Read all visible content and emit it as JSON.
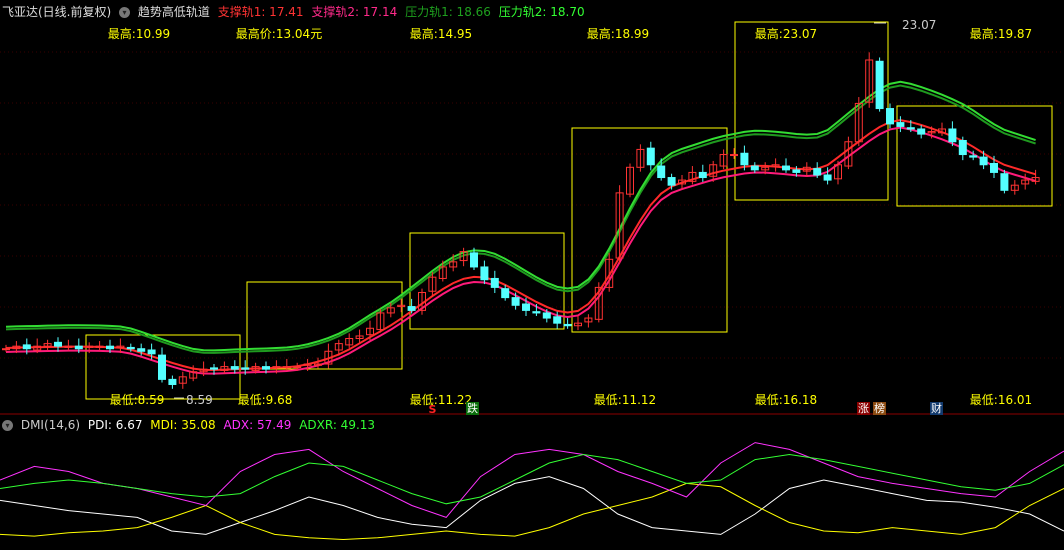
{
  "header": {
    "stock": "飞亚达(日线.前复权)",
    "indicator": "趋势高低轨道",
    "s1": "支撑轨1: 17.41",
    "s2": "支撑轨2: 17.14",
    "r1": "压力轨1: 18.66",
    "r2": "压力轨2: 18.70"
  },
  "dmi": {
    "name": "DMI(14,6)",
    "pdi": "PDI: 6.67",
    "mdi": "MDI: 35.08",
    "adx": "ADX: 57.49",
    "adxr": "ADXR: 49.13"
  },
  "box_labels": {
    "highs": [
      "最高:10.99",
      "最高价:13.04元",
      "最高:14.95",
      "最高:18.99",
      "最高:23.07",
      "最高:19.87"
    ],
    "lows": [
      "最低:8.59",
      "最低:9.68",
      "最低:11.22",
      "最低:11.12",
      "最低:16.18",
      "最低:16.01"
    ]
  },
  "markers": {
    "max_price": "23.07",
    "min_price": "8.59",
    "s": "S",
    "die": "跌",
    "zhang": "涨",
    "bang": "榜",
    "cai": "财"
  },
  "colors": {
    "up": "#ff3333",
    "down": "#54ffff",
    "green": "#00cc00",
    "red": "#ff1a4a",
    "box": "#ffff00"
  },
  "chart_data": {
    "type": "candlestick",
    "ylim": [
      8.0,
      24.0
    ],
    "closes": [
      10.4,
      10.5,
      10.4,
      10.5,
      10.6,
      10.5,
      10.5,
      10.4,
      10.5,
      10.5,
      10.4,
      10.5,
      10.4,
      10.3,
      10.2,
      9.2,
      9.0,
      9.3,
      9.5,
      9.6,
      9.6,
      9.7,
      9.6,
      9.6,
      9.7,
      9.6,
      9.7,
      9.7,
      9.7,
      9.8,
      9.8,
      10.3,
      10.6,
      10.8,
      10.9,
      11.2,
      11.8,
      12.0,
      12.1,
      11.9,
      12.6,
      13.2,
      13.6,
      13.8,
      14.2,
      13.6,
      13.1,
      12.8,
      12.4,
      12.1,
      11.9,
      11.8,
      11.6,
      11.4,
      11.3,
      11.4,
      11.6,
      12.8,
      13.9,
      16.5,
      17.5,
      18.2,
      17.6,
      17.1,
      16.8,
      17.0,
      17.3,
      17.1,
      17.6,
      18.0,
      18.0,
      17.6,
      17.4,
      17.5,
      17.6,
      17.4,
      17.3,
      17.5,
      17.2,
      17.0,
      17.6,
      18.5,
      20.0,
      21.7,
      19.8,
      19.2,
      19.1,
      19.0,
      18.8,
      18.9,
      19.0,
      18.5,
      18.0,
      17.9,
      17.6,
      17.3,
      16.6,
      16.8,
      17.0,
      17.1
    ],
    "dmi_series": [
      {
        "name": "PDI",
        "color": "#ffffff",
        "values": [
          28,
          25,
          22,
          20,
          18,
          10,
          8,
          15,
          22,
          30,
          25,
          18,
          14,
          12,
          28,
          38,
          42,
          35,
          20,
          12,
          10,
          8,
          20,
          35,
          40,
          36,
          32,
          28,
          27,
          24,
          20,
          10
        ]
      },
      {
        "name": "MDI",
        "color": "#ffff00",
        "values": [
          8,
          7,
          9,
          10,
          12,
          18,
          25,
          15,
          8,
          6,
          5,
          6,
          8,
          10,
          8,
          7,
          12,
          20,
          25,
          30,
          38,
          36,
          25,
          15,
          10,
          9,
          12,
          10,
          8,
          12,
          25,
          35
        ]
      },
      {
        "name": "ADX",
        "color": "#ff33ff",
        "values": [
          40,
          48,
          45,
          38,
          35,
          30,
          25,
          45,
          55,
          58,
          45,
          35,
          25,
          18,
          42,
          55,
          58,
          55,
          45,
          38,
          30,
          50,
          62,
          58,
          50,
          42,
          38,
          35,
          32,
          30,
          45,
          57
        ]
      },
      {
        "name": "ADXR",
        "color": "#33ff33",
        "values": [
          35,
          38,
          40,
          38,
          35,
          32,
          30,
          32,
          42,
          50,
          48,
          40,
          32,
          26,
          30,
          40,
          50,
          55,
          52,
          45,
          38,
          40,
          52,
          55,
          52,
          48,
          44,
          40,
          36,
          34,
          38,
          49
        ]
      }
    ]
  }
}
